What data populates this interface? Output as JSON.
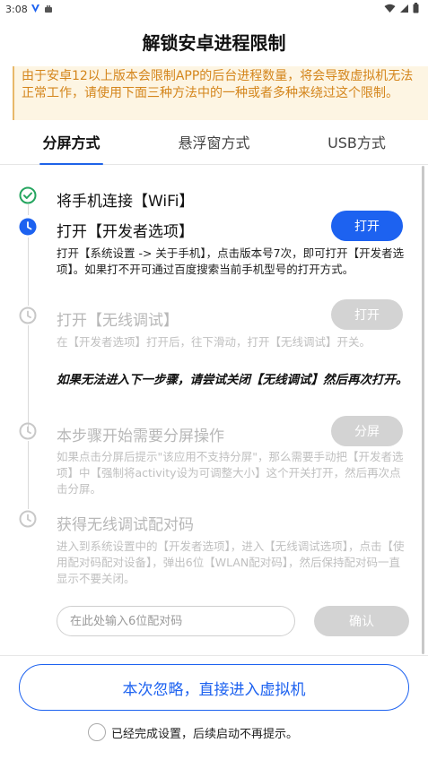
{
  "status_bar": {
    "time": "3:08",
    "left_icons": [
      "vpn-v-icon",
      "app-notification-icon"
    ],
    "right_icons": [
      "wifi-icon",
      "signal-icon",
      "battery-icon"
    ]
  },
  "page_title": "解锁安卓进程限制",
  "notice": {
    "text": "由于安卓12以上版本会限制APP的后台进程数量，将会导致虚拟机无法正常工作，请使用下面三种方法中的一种或者多种来绕过这个限制。"
  },
  "tabs": [
    {
      "label": "分屏方式",
      "active": true
    },
    {
      "label": "悬浮窗方式",
      "active": false
    },
    {
      "label": "USB方式",
      "active": false
    }
  ],
  "steps": [
    {
      "status": "done",
      "icon": "check-circle-icon",
      "title": "将手机连接【WiFi】"
    },
    {
      "status": "current",
      "icon": "clock-icon",
      "title": "打开【开发者选项】",
      "button": "打开",
      "description": "打开【系统设置 -> 关于手机】，点击版本号7次，即可打开【开发者选项】。如果打不开可通过百度搜索当前手机型号的打开方式。"
    },
    {
      "status": "pending",
      "icon": "clock-icon",
      "title": "打开【无线调试】",
      "button": "打开",
      "description": "在【开发者选项】打开后，往下滑动，打开【无线调试】开关。",
      "warning": "如果无法进入下一步骤，请尝试关闭【无线调试】然后再次打开。"
    },
    {
      "status": "pending",
      "icon": "clock-icon",
      "title": "本步骤开始需要分屏操作",
      "button": "分屏",
      "description": "如果点击分屏后提示\"该应用不支持分屏\"，那么需要手动把【开发者选项】中【强制将activity设为可调整大小】这个开关打开，然后再次点击分屏。"
    },
    {
      "status": "pending",
      "icon": "clock-icon",
      "title": "获得无线调试配对码",
      "description": "进入到系统设置中的【开发者选项】，进入【无线调试选项】，点击【使用配对码配对设备】，弹出6位【WLAN配对码】，然后保持配对码一直显示不要关闭。"
    }
  ],
  "pair_code": {
    "placeholder": "在此处输入6位配对码",
    "value": "",
    "confirm_label": "确认"
  },
  "ignore_button": "本次忽略，直接进入虚拟机",
  "dont_show_again": {
    "label": "已经完成设置，后续启动不再提示。",
    "checked": false
  },
  "colors": {
    "accent": "#1d62f0",
    "done": "#25a55f",
    "disabled": "#c8c8c8",
    "notice_bg": "#fdf5e3",
    "notice_text": "#d4851b"
  }
}
